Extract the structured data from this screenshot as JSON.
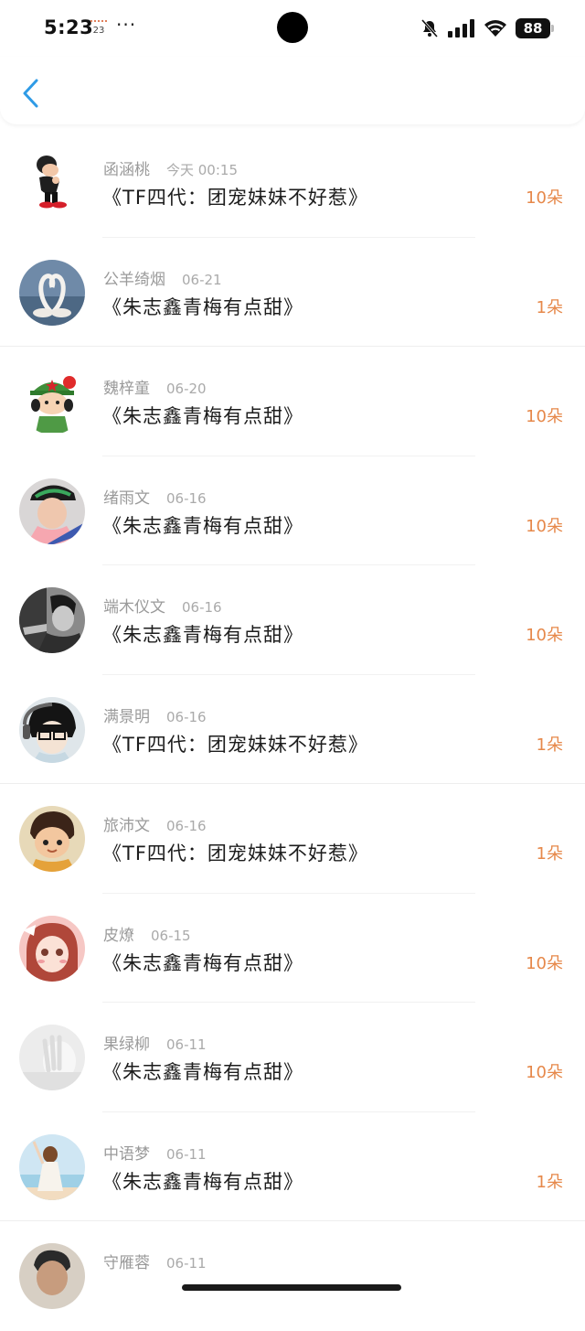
{
  "status_bar": {
    "time": "5:23",
    "calendar_day": "23",
    "dots": "···",
    "battery": "88"
  },
  "header": {
    "back_icon": "chevron-left-icon",
    "accent_color": "#2f9be6"
  },
  "colors": {
    "count_color": "#e6884a",
    "name_color": "#9a9a9a"
  },
  "items": [
    {
      "name": "函涵桃",
      "date": "今天 00:15",
      "book": "《TF四代：团宠妹妹不好惹》",
      "count": "10朵",
      "avatar": "cartoon-character"
    },
    {
      "name": "公羊绮烟",
      "date": "06-21",
      "book": "《朱志鑫青梅有点甜》",
      "count": "1朵",
      "avatar": "swans-heart"
    },
    {
      "name": "魏梓童",
      "date": "06-20",
      "book": "《朱志鑫青梅有点甜》",
      "count": "10朵",
      "avatar": "cartoon-soldier-girl"
    },
    {
      "name": "绪雨文",
      "date": "06-16",
      "book": "《朱志鑫青梅有点甜》",
      "count": "10朵",
      "avatar": "boy-with-cap"
    },
    {
      "name": "端木仪文",
      "date": "06-16",
      "book": "《朱志鑫青梅有点甜》",
      "count": "10朵",
      "avatar": "grayscale-portrait"
    },
    {
      "name": "满景明",
      "date": "06-16",
      "book": "《TF四代：团宠妹妹不好惹》",
      "count": "1朵",
      "avatar": "anime-boy-glasses"
    },
    {
      "name": "旅沛文",
      "date": "06-16",
      "book": "《TF四代：团宠妹妹不好惹》",
      "count": "1朵",
      "avatar": "cartoon-boy"
    },
    {
      "name": "皮燎",
      "date": "06-15",
      "book": "《朱志鑫青梅有点甜》",
      "count": "10朵",
      "avatar": "anime-girl-pink"
    },
    {
      "name": "果绿柳",
      "date": "06-11",
      "book": "《朱志鑫青梅有点甜》",
      "count": "10朵",
      "avatar": "white-hand"
    },
    {
      "name": "中语梦",
      "date": "06-11",
      "book": "《朱志鑫青梅有点甜》",
      "count": "1朵",
      "avatar": "girl-at-sea"
    },
    {
      "name": "守雁蓉",
      "date": "06-11",
      "book": "",
      "count": "",
      "avatar": "man-portrait"
    }
  ]
}
